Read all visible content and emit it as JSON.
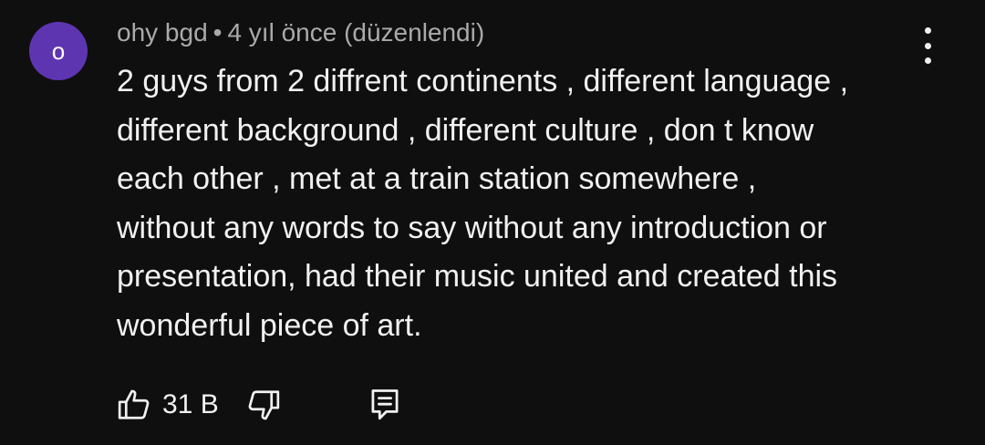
{
  "comment": {
    "avatar_letter": "o",
    "avatar_color": "#5e35b1",
    "author": "ohy bgd",
    "separator": "•",
    "time": "4 yıl önce (düzenlendi)",
    "text_lines": [
      "2 guys from 2 diffrent continents , different language ,",
      "different background , different culture , don t know",
      "each other , met at a train station somewhere ,",
      "without any words to say without any introduction or",
      "presentation, had their music united and created this",
      "wonderful piece of art."
    ],
    "like_count": "31 B",
    "icons": {
      "menu": "more-vert-icon",
      "like": "thumbs-up-icon",
      "dislike": "thumbs-down-icon",
      "reply": "reply-comment-icon"
    }
  }
}
